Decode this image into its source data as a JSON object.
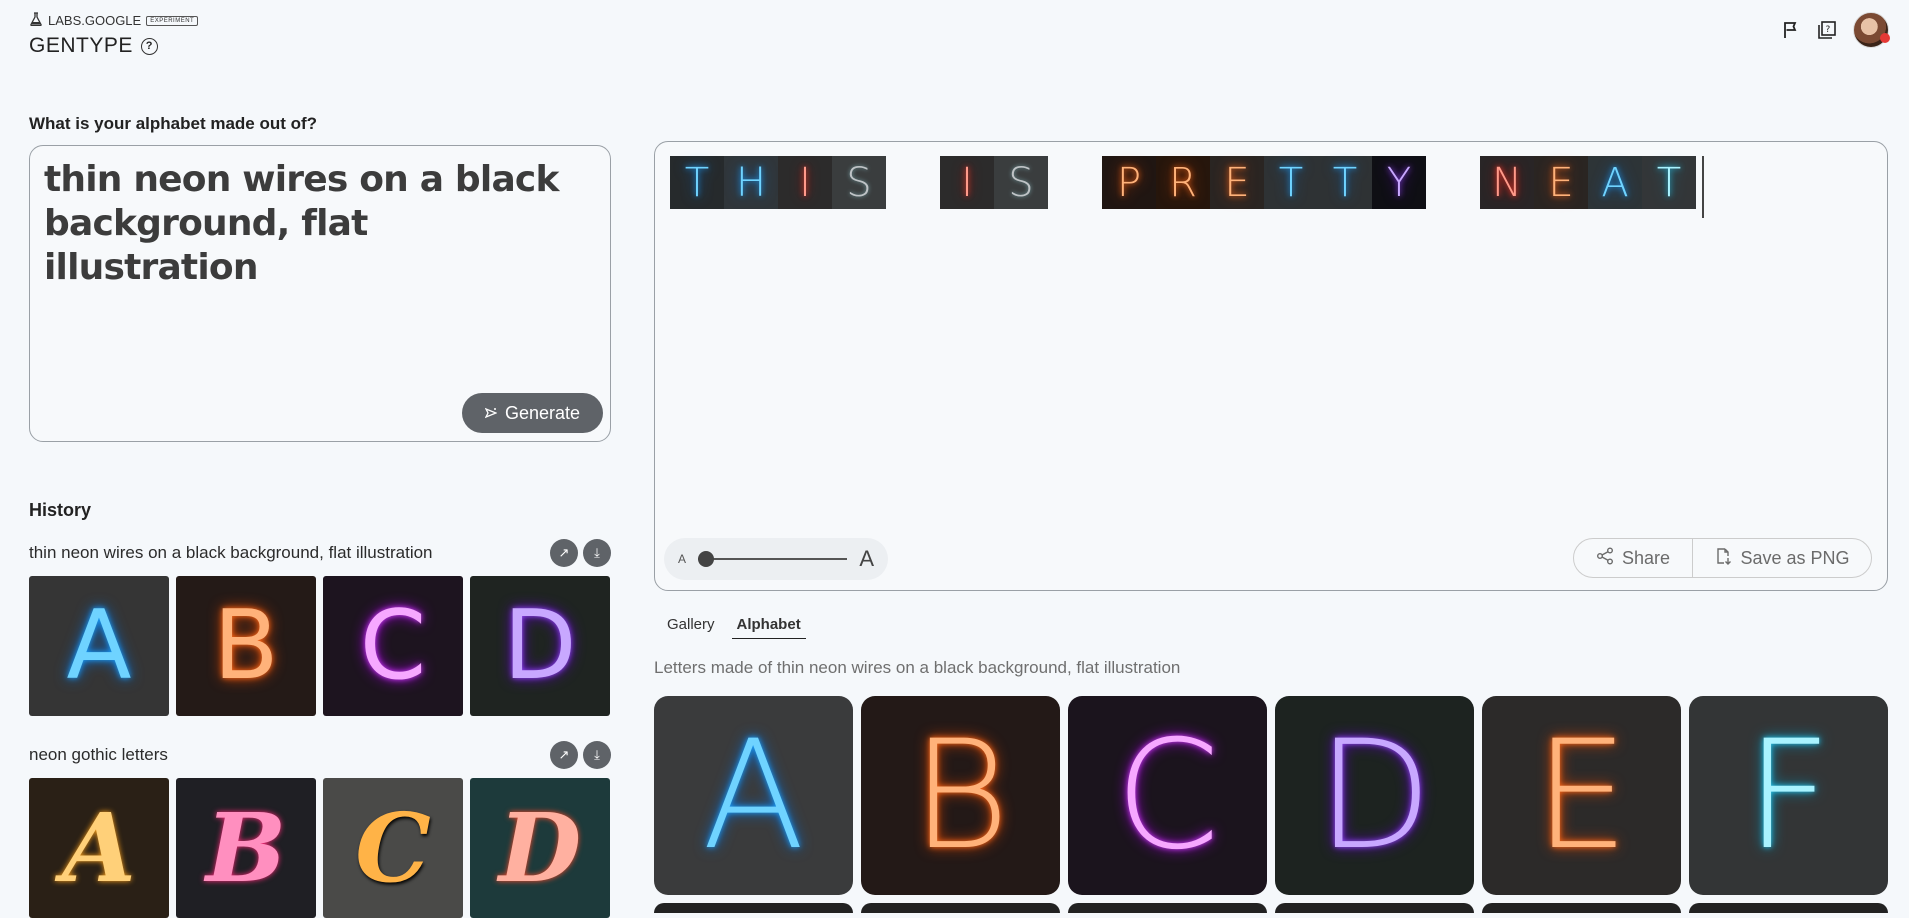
{
  "header": {
    "brand": "LABS.GOOGLE",
    "badge": "EXPERIMENT",
    "title": "GENTYPE",
    "help_glyph": "?",
    "icons": [
      "flag-icon",
      "feedback-icon",
      "avatar"
    ]
  },
  "prompt": {
    "label": "What is your alphabet made out of?",
    "value": "thin neon wires on a black background, flat illustration",
    "generate_label": "Generate"
  },
  "history": {
    "title": "History",
    "items": [
      {
        "name": "thin neon wires on a black background, flat illustration",
        "letters": [
          "A",
          "B",
          "C",
          "D"
        ]
      },
      {
        "name": "neon gothic letters",
        "letters": [
          "A",
          "B",
          "C",
          "D"
        ]
      }
    ]
  },
  "canvas": {
    "words": [
      {
        "text": "THIS",
        "letters": [
          "T",
          "H",
          "I",
          "S"
        ]
      },
      {
        "text": "IS",
        "letters": [
          "I",
          "S"
        ]
      },
      {
        "text": "PRETTY",
        "letters": [
          "P",
          "R",
          "E",
          "T",
          "T",
          "Y"
        ]
      },
      {
        "text": "NEAT",
        "letters": [
          "N",
          "E",
          "A",
          "T"
        ]
      }
    ],
    "size_small": "A",
    "size_large": "A",
    "share_label": "Share",
    "save_label": "Save as PNG"
  },
  "tabs": [
    {
      "label": "Gallery",
      "active": false
    },
    {
      "label": "Alphabet",
      "active": true
    }
  ],
  "alphabet": {
    "description": "Letters made of thin neon wires on a black background, flat illustration",
    "letters": [
      "A",
      "B",
      "C",
      "D",
      "E",
      "F"
    ]
  },
  "colors": {
    "accent": "#5f6368",
    "background": "#f5f8fb",
    "border": "#9aa0a6"
  }
}
